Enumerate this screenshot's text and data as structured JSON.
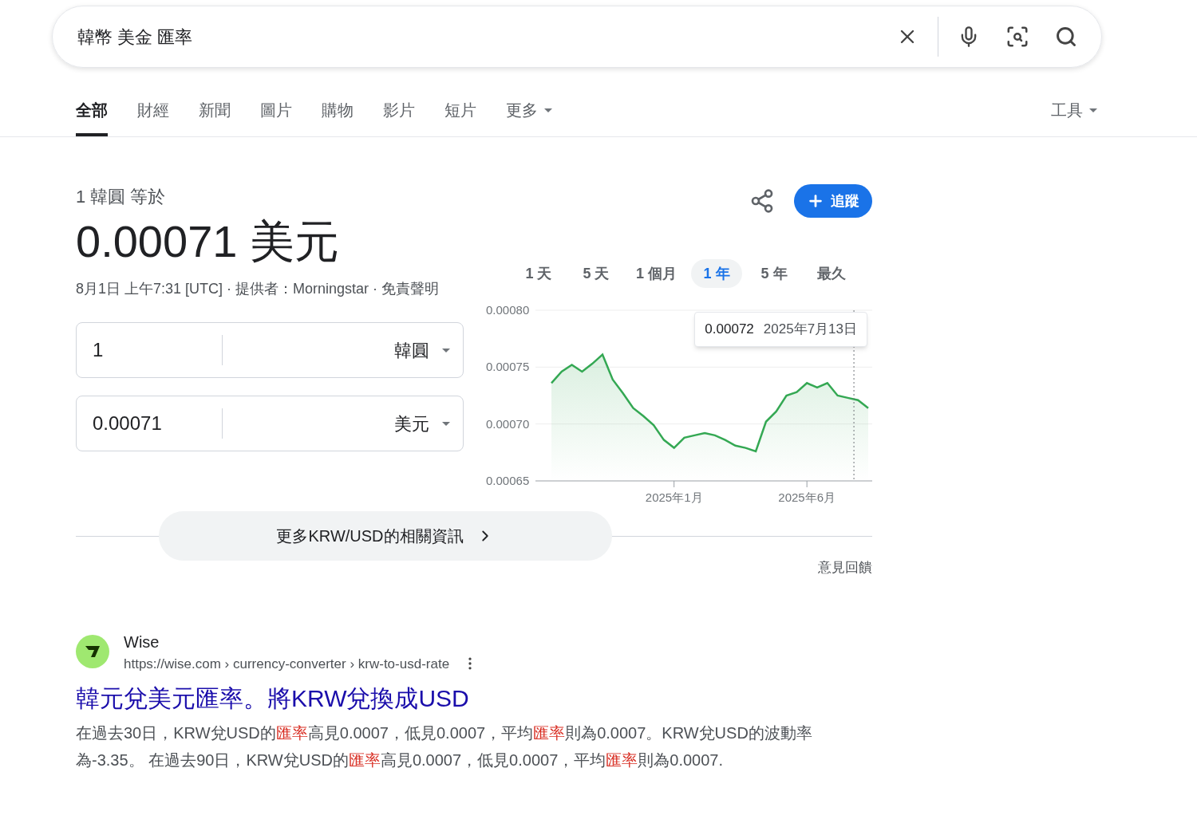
{
  "search": {
    "value": "韓幣 美金 匯率"
  },
  "tabs": [
    {
      "label": "全部",
      "selected": true
    },
    {
      "label": "財經",
      "selected": false
    },
    {
      "label": "新聞",
      "selected": false
    },
    {
      "label": "圖片",
      "selected": false
    },
    {
      "label": "購物",
      "selected": false
    },
    {
      "label": "影片",
      "selected": false
    },
    {
      "label": "短片",
      "selected": false
    },
    {
      "label": "更多",
      "selected": false,
      "kind": "menu"
    }
  ],
  "tools": "工具",
  "converter": {
    "caption": "1 韓圓 等於",
    "result": "0.00071 美元",
    "meta": "8月1日 上午7:31 [UTC] · 提供者：Morningstar · ",
    "disclaimer": "免責聲明",
    "follow": "追蹤",
    "fields": [
      {
        "value": "1",
        "currency": "韓圓"
      },
      {
        "value": "0.00071",
        "currency": "美元"
      }
    ],
    "periods": [
      {
        "label": "1 天",
        "selected": false
      },
      {
        "label": "5 天",
        "selected": false
      },
      {
        "label": "1 個月",
        "selected": false
      },
      {
        "label": "1 年",
        "selected": true
      },
      {
        "label": "5 年",
        "selected": false
      },
      {
        "label": "最久",
        "selected": false
      }
    ],
    "tooltip": {
      "value": "0.00072",
      "date": "2025年7月13日"
    },
    "chart_data": {
      "type": "area",
      "ylim": [
        0.00065,
        0.0008
      ],
      "categories": [
        null,
        null,
        null,
        null,
        null,
        null,
        null,
        null,
        null,
        null,
        null,
        null,
        "2025年1月",
        null,
        null,
        null,
        null,
        null,
        null,
        null,
        null,
        null,
        null,
        null,
        null,
        "2025年6月",
        null,
        null,
        null,
        null,
        null,
        null
      ],
      "series": [
        {
          "color": "#34a853",
          "values": [
            0.000736,
            0.000746,
            0.000752,
            0.000746,
            0.000753,
            0.000761,
            0.000739,
            0.000727,
            0.000714,
            0.000707,
            0.000699,
            0.000686,
            0.000679,
            0.000688,
            0.00069,
            0.000692,
            0.00069,
            0.000686,
            0.000681,
            0.000679,
            0.000676,
            0.000702,
            0.000711,
            0.000725,
            0.000728,
            0.000736,
            0.000732,
            0.000736,
            0.000725,
            0.000723,
            0.000721,
            0.000714
          ]
        }
      ],
      "yticks": [
        {
          "value": 0.00065,
          "label": "0.00065"
        },
        {
          "value": 0.0007,
          "label": "0.00070"
        },
        {
          "value": 0.00075,
          "label": "0.00075"
        },
        {
          "value": 0.0008,
          "label": "0.00080"
        }
      ]
    },
    "more": "更多KRW/USD的相關資訊",
    "feedback": "意見回饋"
  },
  "result": {
    "site": "Wise",
    "url": "https://wise.com › currency-converter › krw-to-usd-rate",
    "title": "韓元兌美元匯率。將KRW兌換成USD",
    "snippet": "在過去30日，KRW兌USD的**匯率**高見0.0007，低見0.0007，平均**匯率**則為0.0007。KRW兌USD的波動率為-3.35。 在過去90日，KRW兌USD的**匯率**高見0.0007，低見0.0007，平均**匯率**則為0.0007."
  }
}
